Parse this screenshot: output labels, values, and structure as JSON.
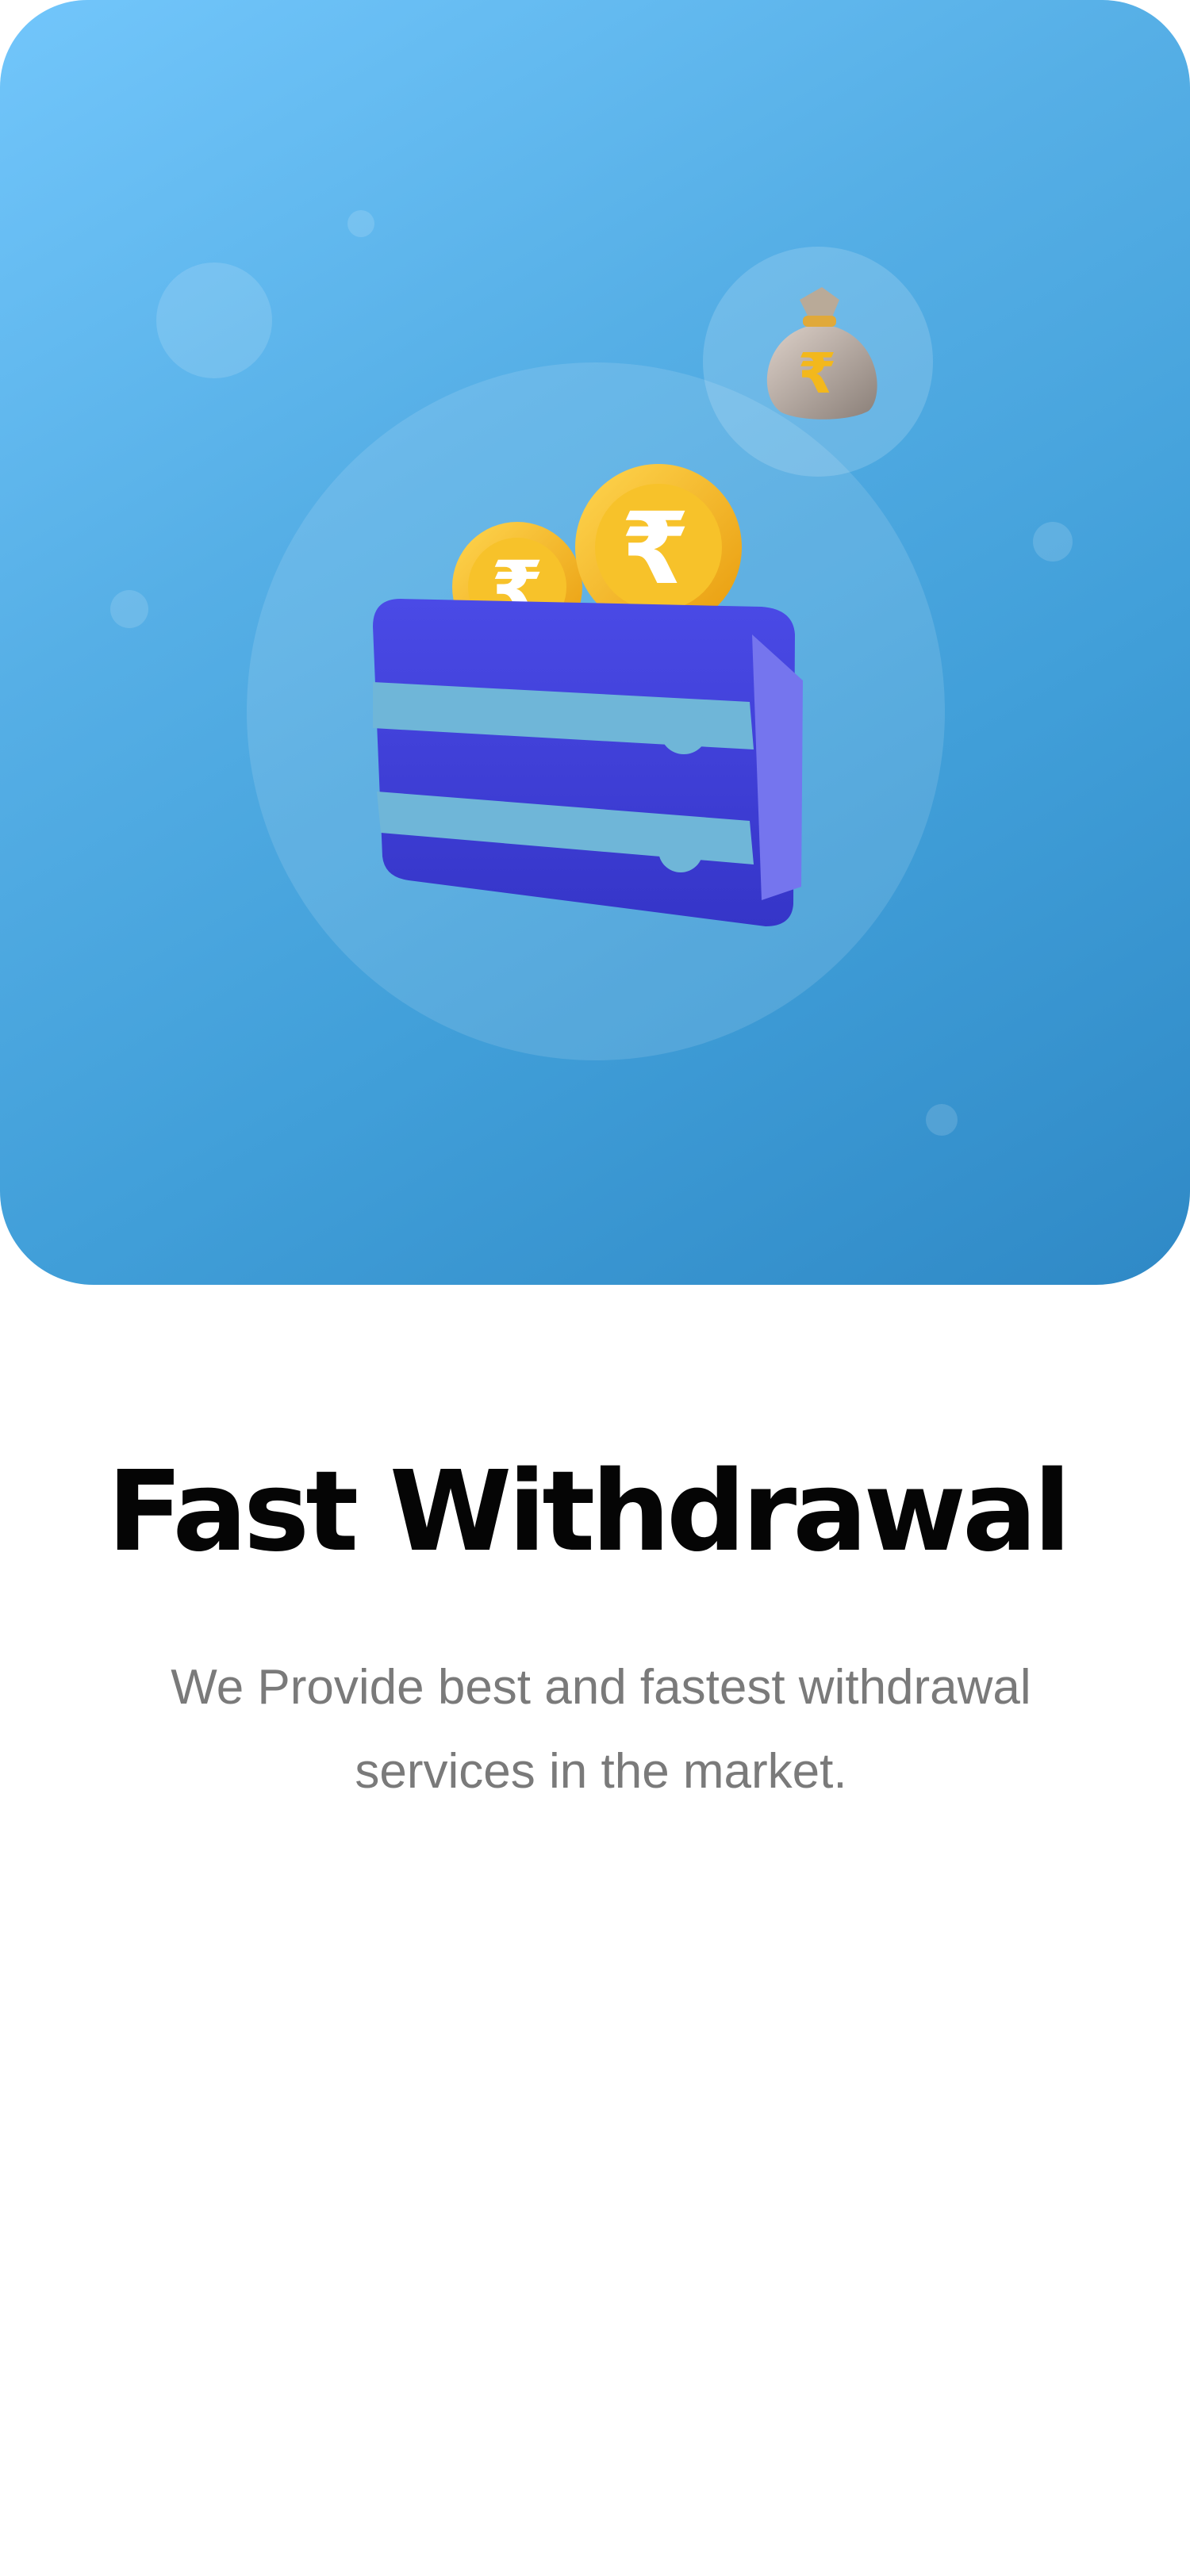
{
  "onboarding": {
    "title": "Fast Withdrawal",
    "description": "We Provide best and fastest withdrawal services in the market."
  },
  "illustration": {
    "main_icon": "wallet-with-rupee-coins-icon",
    "secondary_icon": "rupee-money-bag-icon",
    "currency_symbol": "₹"
  },
  "colors": {
    "hero_gradient_start": "#72c6fb",
    "hero_gradient_end": "#2f89c6",
    "wallet": "#3f3fd6",
    "wallet_strap": "#6fb6d8",
    "coin": "#f3b81c",
    "title": "#050505",
    "description": "#7a7a7a"
  }
}
